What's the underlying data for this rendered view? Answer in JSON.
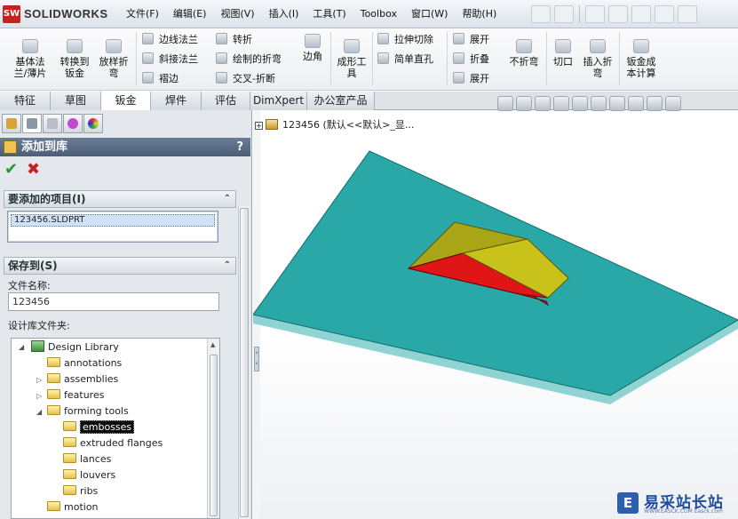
{
  "app": {
    "logo_badge": "SW",
    "logo_text": "SOLIDWORKS"
  },
  "menu": [
    "文件(F)",
    "编辑(E)",
    "视图(V)",
    "插入(I)",
    "工具(T)",
    "Toolbox",
    "窗口(W)",
    "帮助(H)"
  ],
  "ribbon": {
    "base_flange": "基体法\n兰/薄片",
    "convert": "转换到\n钣金",
    "lofted_bend": "放样折\n弯",
    "edge_flange": "边线法兰",
    "miter_flange": "斜接法兰",
    "hem": "褶边",
    "jog": "转折",
    "sketched_bend": "绘制的折弯",
    "cross_break": "交叉-折断",
    "corners": "边角",
    "forming_tool": "成形工\n具",
    "extruded_cut": "拉伸切除",
    "simple_hole": "简单直孔",
    "unfold": "展开",
    "fold": "折叠",
    "flatten": "展开",
    "no_bends": "不折弯",
    "rip": "切口",
    "insert_bends": "插入折\n弯",
    "sheet_metal_cost": "钣金成\n本计算"
  },
  "tabs": [
    "特征",
    "草图",
    "钣金",
    "焊件",
    "评估",
    "DimXpert",
    "办公室产品"
  ],
  "active_tab": "钣金",
  "panel": {
    "title": "添加到库",
    "help": "?",
    "ok_symbol": "✔",
    "cancel_symbol": "✖",
    "items_group": "要添加的项目(I)",
    "items": [
      "123456.SLDPRT"
    ],
    "save_group": "保存到(S)",
    "file_name_label": "文件名称:",
    "file_name_value": "123456",
    "library_folder_label": "设计库文件夹:",
    "collapse_symbol": "⌃"
  },
  "tree": {
    "root": "Design Library",
    "folders": [
      "annotations",
      "assemblies",
      "features",
      "forming tools"
    ],
    "subfolders": [
      "embosses",
      "extruded flanges",
      "lances",
      "louvers",
      "ribs"
    ],
    "selected": "embosses",
    "last": "motion"
  },
  "feature_tree": {
    "expander": "+",
    "label": "123456 (默认<<默认>_显..."
  },
  "model_colors": {
    "plate_top": "#2aa7a7",
    "plate_side": "#8fd3d3",
    "boss_top": "#a9a516",
    "boss_front": "#e01515",
    "boss_right": "#c9c21b"
  },
  "watermark": {
    "badge": "E",
    "text": "易采站长站",
    "sub": "WWW.EASCK.COM  Easck.com"
  }
}
